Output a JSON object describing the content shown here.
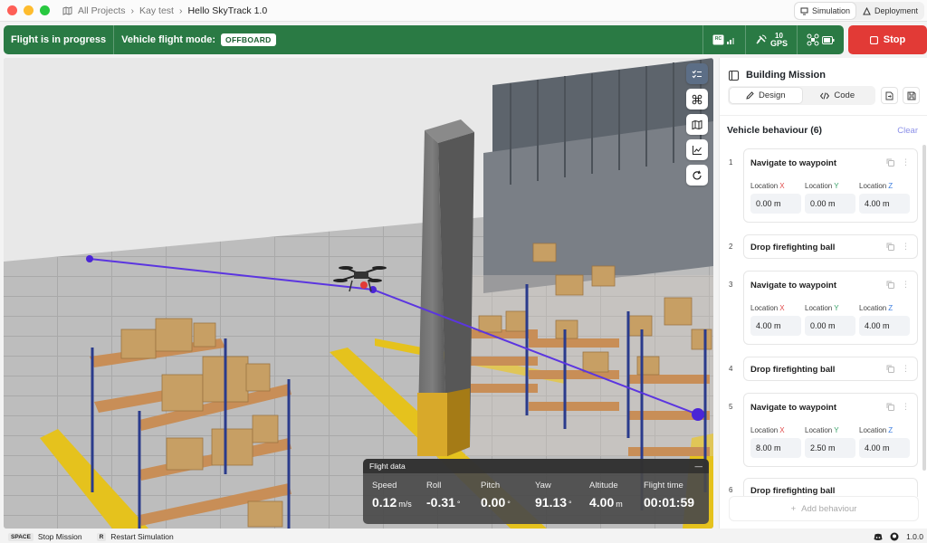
{
  "breadcrumb": {
    "root": "All Projects",
    "project": "Kay test",
    "current": "Hello SkyTrack 1.0"
  },
  "mode_switch": {
    "simulation": "Simulation",
    "deployment": "Deployment"
  },
  "status": {
    "flight_state": "Flight is in progress",
    "mode_label": "Vehicle flight mode:",
    "mode_value": "OFFBOARD",
    "rc_label": "RC",
    "gps_count": "10",
    "gps_label": "GPS",
    "color": "#2a7a44"
  },
  "stop_label": "Stop",
  "flight_data": {
    "title": "Flight data",
    "metrics": [
      {
        "label": "Speed",
        "value": "0.12",
        "unit": "m/s"
      },
      {
        "label": "Roll",
        "value": "-0.31",
        "unit": "°"
      },
      {
        "label": "Pitch",
        "value": "0.00",
        "unit": "°"
      },
      {
        "label": "Yaw",
        "value": "91.13",
        "unit": "°"
      },
      {
        "label": "Altitude",
        "value": "4.00",
        "unit": "m"
      },
      {
        "label": "Flight time",
        "value": "00:01:59",
        "unit": ""
      }
    ]
  },
  "panel": {
    "title": "Building Mission",
    "tab_design": "Design",
    "tab_code": "Code",
    "behaviour_header": "Vehicle behaviour (6)",
    "clear": "Clear",
    "add_behaviour": "Add behaviour",
    "loc_label": "Location",
    "axes": [
      "X",
      "Y",
      "Z"
    ],
    "steps": [
      {
        "n": "1",
        "title": "Navigate to waypoint",
        "loc": [
          "0.00 m",
          "0.00 m",
          "4.00 m"
        ]
      },
      {
        "n": "2",
        "title": "Drop firefighting ball"
      },
      {
        "n": "3",
        "title": "Navigate to waypoint",
        "loc": [
          "4.00 m",
          "0.00 m",
          "4.00 m"
        ]
      },
      {
        "n": "4",
        "title": "Drop firefighting ball"
      },
      {
        "n": "5",
        "title": "Navigate to waypoint",
        "loc": [
          "8.00 m",
          "2.50 m",
          "4.00 m"
        ]
      },
      {
        "n": "6",
        "title": "Drop firefighting ball"
      }
    ]
  },
  "footer": {
    "key1": "SPACE",
    "action1": "Stop Mission",
    "key2": "R",
    "action2": "Restart Simulation",
    "version": "1.0.0"
  }
}
